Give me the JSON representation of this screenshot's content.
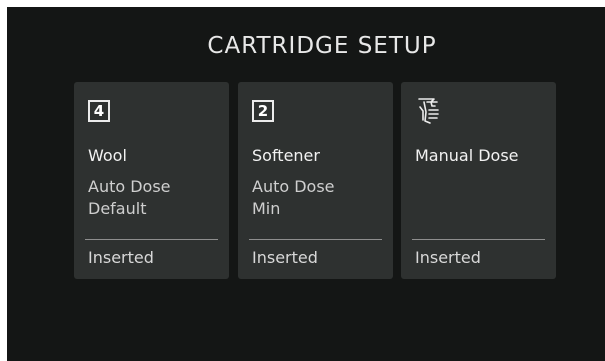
{
  "header": {
    "title": "CARTRIDGE SETUP"
  },
  "cards": [
    {
      "slot": "4",
      "name": "Wool",
      "mode_line1": "Auto Dose",
      "mode_line2": "Default",
      "status": "Inserted"
    },
    {
      "slot": "2",
      "name": "Softener",
      "mode_line1": "Auto Dose",
      "mode_line2": "Min",
      "status": "Inserted"
    },
    {
      "icon": "manual-dose-hand-icon",
      "name": "Manual Dose",
      "status": "Inserted"
    }
  ],
  "colors": {
    "background": "#141615",
    "card": "#2e3130",
    "text": "#f2f2f2"
  }
}
